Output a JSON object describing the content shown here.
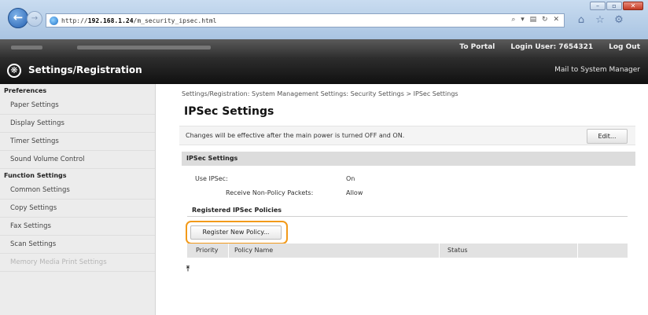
{
  "browser": {
    "url_prefix": "http://",
    "url_host": "192.168.1.24",
    "url_path": "/m_security_ipsec.html",
    "addr_tools": "⌕ ▾ ▤ ↻ ✕",
    "window_buttons": [
      "–",
      "▫",
      "✕"
    ]
  },
  "topbar": {
    "links": [
      "To Portal",
      "Login User:  7654321",
      "Log Out"
    ]
  },
  "header": {
    "title": "Settings/Registration",
    "mail_link": "Mail to System Manager"
  },
  "sidebar": {
    "sections": [
      {
        "title": "Preferences",
        "items": [
          "Paper Settings",
          "Display Settings",
          "Timer Settings",
          "Sound Volume Control"
        ]
      },
      {
        "title": "Function Settings",
        "items": [
          "Common Settings",
          "Copy Settings",
          "Fax Settings",
          "Scan Settings",
          "Memory Media Print Settings"
        ]
      }
    ]
  },
  "main": {
    "breadcrumb": "Settings/Registration: System Management Settings: Security Settings > IPSec Settings",
    "title": "IPSec Settings",
    "notice": "Changes will be effective after the main power is turned OFF and ON.",
    "edit_label": "Edit...",
    "section_title": "IPSec Settings",
    "use_ipsec_label": "Use IPSec:",
    "use_ipsec_value": "On",
    "receive_label": "Receive Non-Policy Packets:",
    "receive_value": "Allow",
    "policies_title": "Registered IPSec Policies",
    "register_label": "Register New Policy...",
    "columns": [
      "Priority",
      "Policy Name",
      "Status"
    ],
    "scroll_icon": "⤒"
  }
}
